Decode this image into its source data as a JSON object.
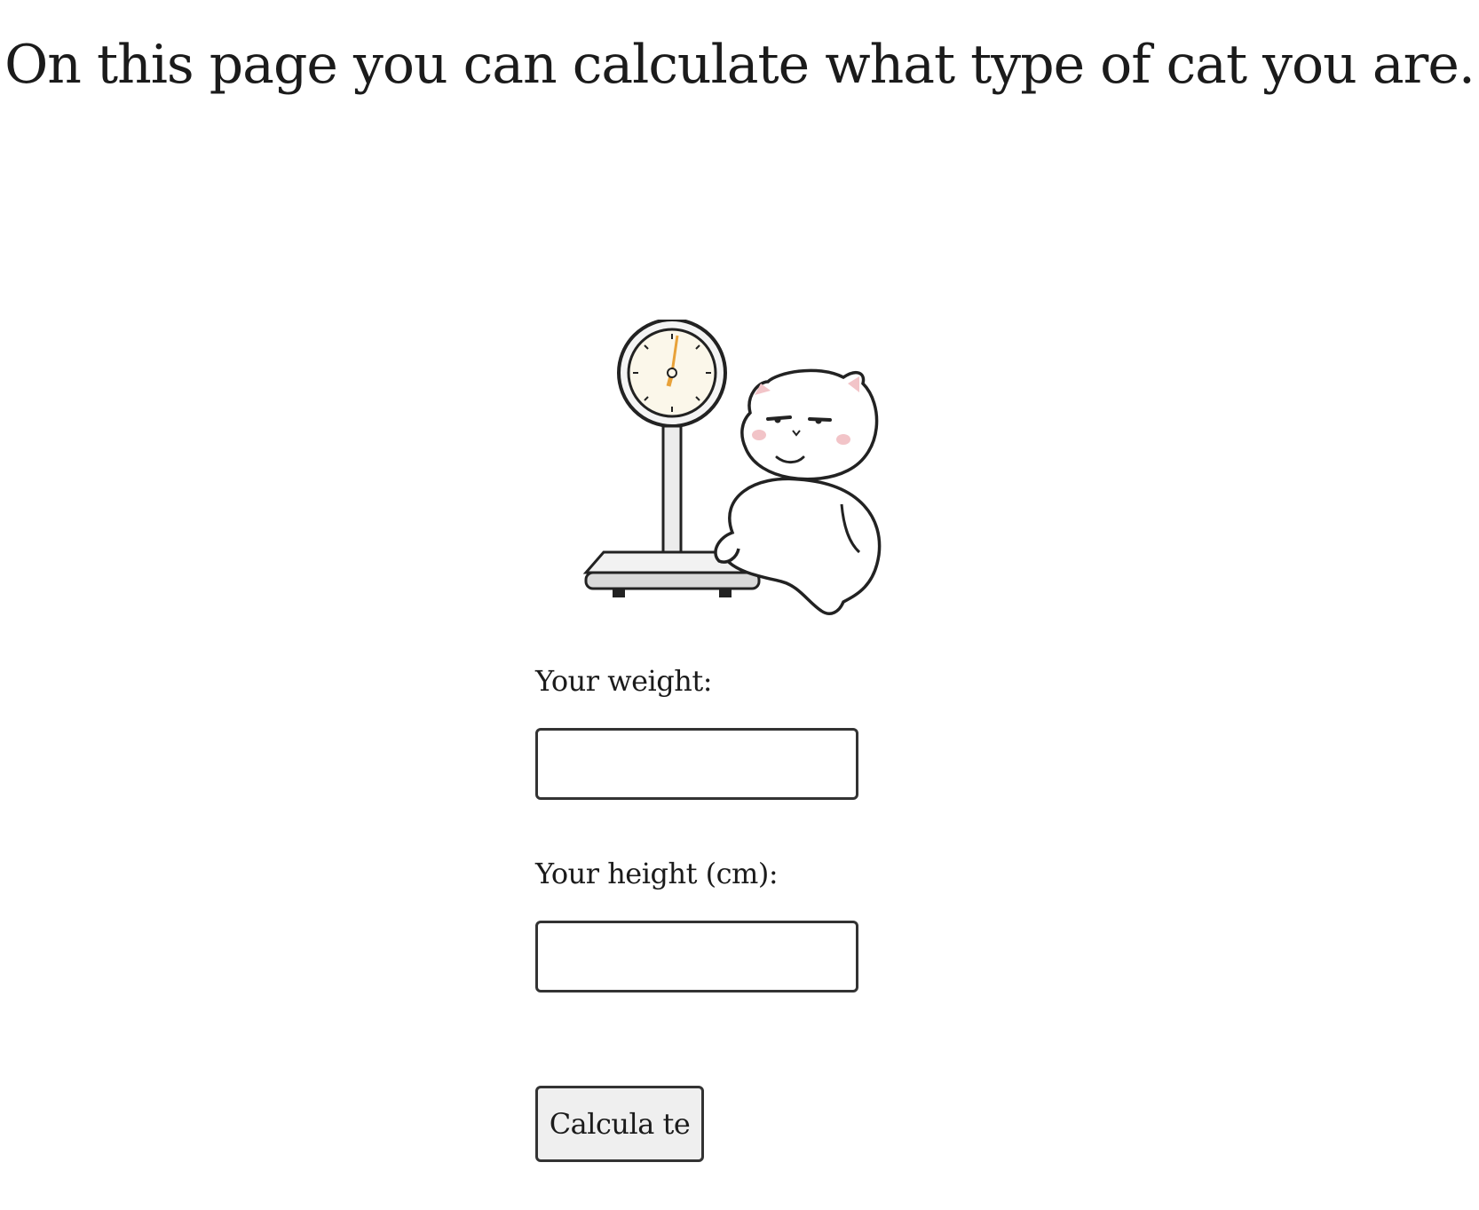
{
  "page": {
    "title": "On this page you can calculate what type of cat you are."
  },
  "illustration": {
    "icon": "cat-on-scale-illustration"
  },
  "form": {
    "weight_label": "Your weight:",
    "weight_value": "",
    "height_label": "Your height (cm):",
    "height_value": "",
    "button_label": "Calcula te"
  },
  "colors": {
    "background": "#ffffff",
    "text": "#1b1b1b",
    "border": "#333333",
    "button_background": "#efefef",
    "needle": "#e8a23a",
    "cheek": "#f2c4c8"
  }
}
